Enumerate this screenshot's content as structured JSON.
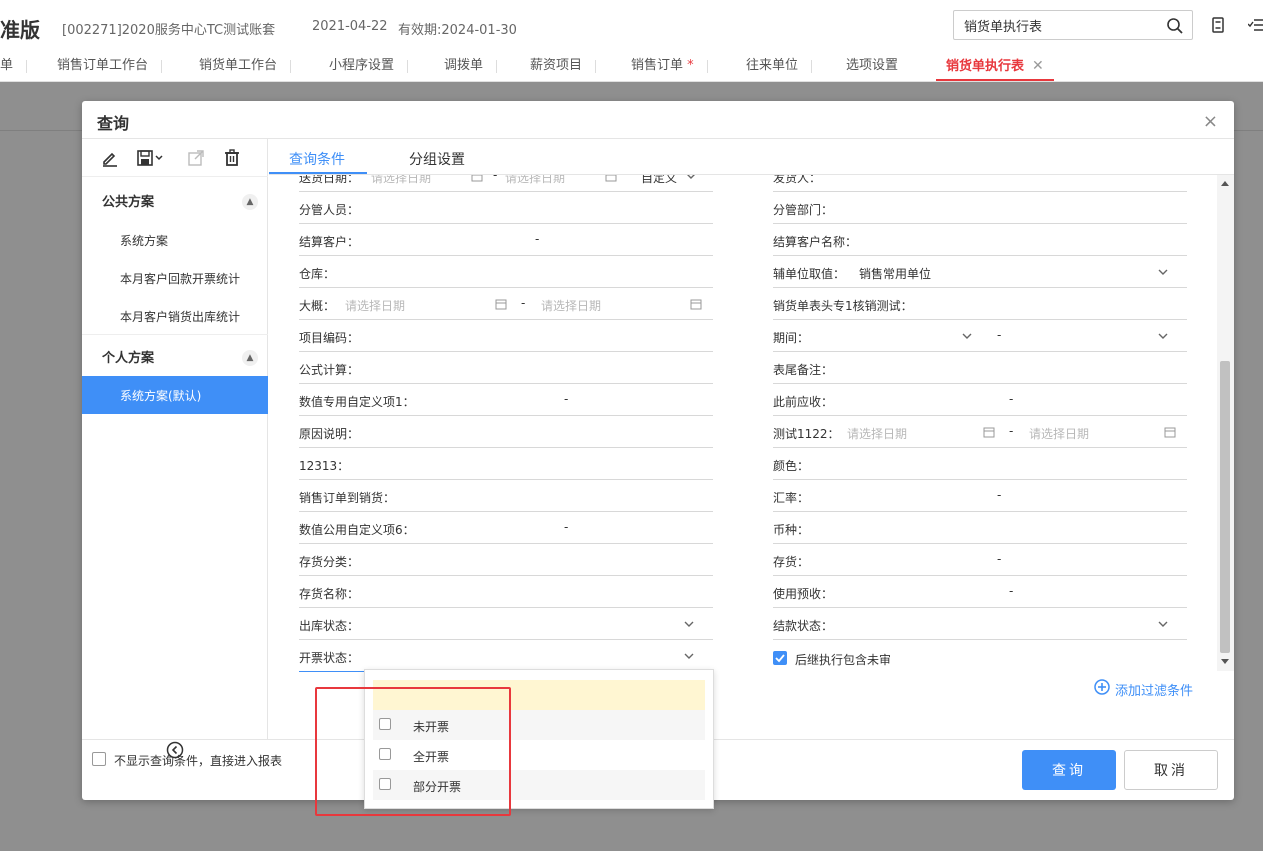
{
  "header": {
    "brand": "准版",
    "account": "[002271]2020服务中心TC测试账套",
    "date": "2021-04-22",
    "valid": "有效期:2024-01-30",
    "search_value": "销货单执行表"
  },
  "tabs": [
    {
      "label": "单"
    },
    {
      "label": "销售订单工作台"
    },
    {
      "label": "销货单工作台"
    },
    {
      "label": "小程序设置"
    },
    {
      "label": "调拨单"
    },
    {
      "label": "薪资项目"
    },
    {
      "label": "销售订单",
      "mark": "*"
    },
    {
      "label": "往来单位"
    },
    {
      "label": "选项设置"
    },
    {
      "label": "销货单执行表",
      "active": true,
      "close": "✕"
    }
  ],
  "modal": {
    "title": "查询",
    "close": "×",
    "tabs": [
      "查询条件",
      "分组设置"
    ],
    "public_group": "公共方案",
    "public_schemes": [
      "系统方案",
      "本月客户回款开票统计",
      "本月客户销货出库统计"
    ],
    "personal_group": "个人方案",
    "personal_schemes": [
      "系统方案(默认)"
    ],
    "add_filter": "添加过滤条件",
    "skip_label": "不显示查询条件，直接进入报表",
    "query_btn": "查询",
    "cancel_btn": "取消",
    "date_placeholder": "请选择日期",
    "custom": "自定义",
    "sub_unit_value": "销售常用单位",
    "include_unaudited": "后继执行包含未审"
  },
  "form_left": [
    "送货日期：",
    "分管人员：",
    "结算客户：",
    "仓库：",
    "大概：",
    "项目编码：",
    "公式计算：",
    "数值专用自定义项1：",
    "原因说明：",
    "12313：",
    "销售订单到销货：",
    "数值公用自定义项6：",
    "存货分类：",
    "存货名称：",
    "出库状态：",
    "开票状态："
  ],
  "form_right": [
    "发货人：",
    "分管部门：",
    "结算客户名称：",
    "辅单位取值：",
    "销货单表头专1核销测试：",
    "期间：",
    "表尾备注：",
    "此前应收：",
    "测试1122：",
    "颜色：",
    "汇率：",
    "币种：",
    "存货：",
    "使用预收：",
    "结款状态："
  ],
  "dropdown": {
    "options": [
      "未开票",
      "全开票",
      "部分开票"
    ]
  },
  "colors": {
    "accent": "#3f8ff7",
    "active_tab": "#e8383d",
    "highlight": "#fff6d2"
  }
}
